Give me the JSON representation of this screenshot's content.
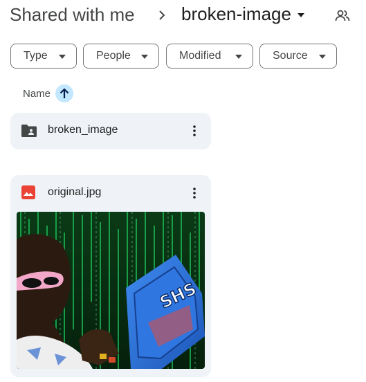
{
  "breadcrumb": {
    "root": "Shared with me",
    "current": "broken-image"
  },
  "icons": {
    "separator": "chevron-right-icon",
    "current_dropdown": "caret-down-icon",
    "share": "people-icon"
  },
  "filters": [
    {
      "label": "Type"
    },
    {
      "label": "People"
    },
    {
      "label": "Modified"
    },
    {
      "label": "Source"
    }
  ],
  "sort": {
    "label": "Name",
    "direction": "ascending",
    "icon": "arrow-up-icon"
  },
  "items": {
    "folder": {
      "name": "broken_image",
      "icon": "shared-folder-icon"
    },
    "file": {
      "name": "original.jpg",
      "icon": "image-file-icon",
      "thumbnail_icon_text": "SHS"
    }
  },
  "colors": {
    "card_bg": "#eff3f8",
    "sort_active": "#c2e7ff",
    "image_icon": "#ea4335",
    "matrix_green": "#1fc25a",
    "laptop_blue": "#2a6fd6"
  }
}
